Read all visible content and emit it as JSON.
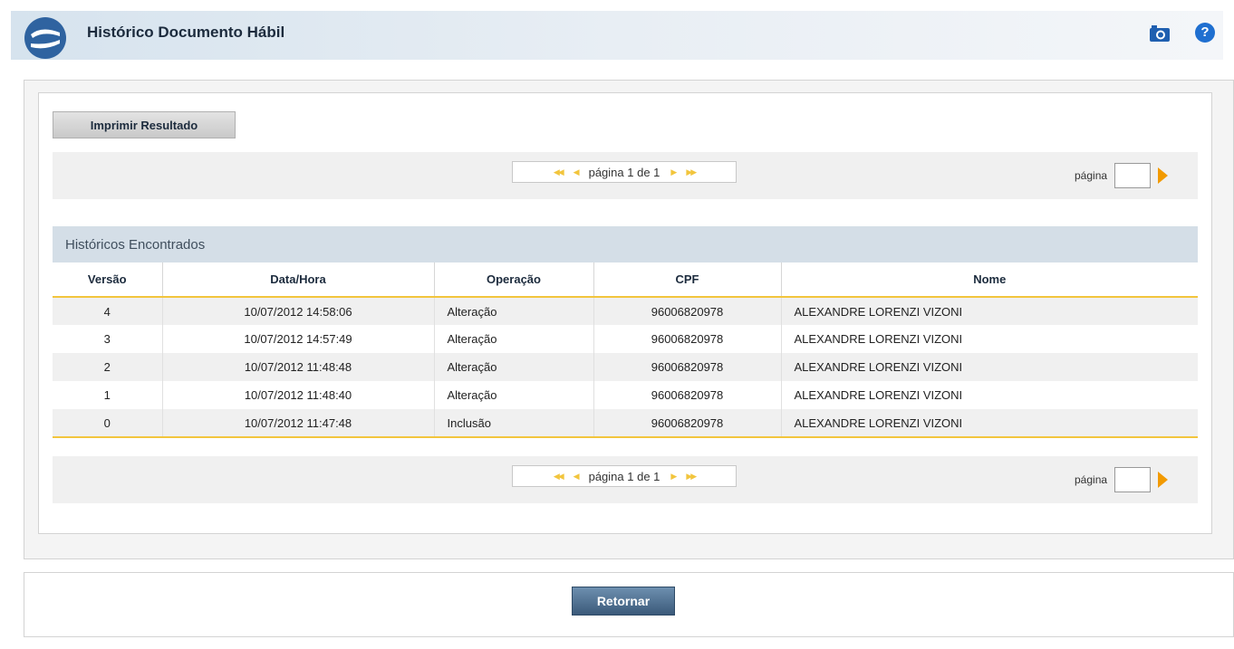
{
  "header": {
    "title": "Histórico Documento Hábil"
  },
  "toolbar": {
    "print_label": "Imprimir Resultado"
  },
  "pagination": {
    "text": "página 1 de 1",
    "go_label": "página",
    "current_page": 1,
    "total_pages": 1
  },
  "table": {
    "title": "Históricos Encontrados",
    "columns": [
      "Versão",
      "Data/Hora",
      "Operação",
      "CPF",
      "Nome"
    ],
    "rows": [
      {
        "versao": "4",
        "datahora": "10/07/2012 14:58:06",
        "operacao": "Alteração",
        "cpf": "96006820978",
        "nome": "ALEXANDRE LORENZI VIZONI"
      },
      {
        "versao": "3",
        "datahora": "10/07/2012 14:57:49",
        "operacao": "Alteração",
        "cpf": "96006820978",
        "nome": "ALEXANDRE LORENZI VIZONI"
      },
      {
        "versao": "2",
        "datahora": "10/07/2012 11:48:48",
        "operacao": "Alteração",
        "cpf": "96006820978",
        "nome": "ALEXANDRE LORENZI VIZONI"
      },
      {
        "versao": "1",
        "datahora": "10/07/2012 11:48:40",
        "operacao": "Alteração",
        "cpf": "96006820978",
        "nome": "ALEXANDRE LORENZI VIZONI"
      },
      {
        "versao": "0",
        "datahora": "10/07/2012 11:47:48",
        "operacao": "Inclusão",
        "cpf": "96006820978",
        "nome": "ALEXANDRE LORENZI VIZONI"
      }
    ]
  },
  "footer": {
    "back_label": "Retornar"
  },
  "icons": {
    "logo": "siafi-logo-icon",
    "camera": "camera-icon",
    "help": "help-icon",
    "first": "first-page-icon",
    "prev": "prev-page-icon",
    "next": "next-page-icon",
    "last": "last-page-icon",
    "go": "go-arrow-icon"
  },
  "colors": {
    "accent": "#f2c53d",
    "header_bg": "#d6e3ee",
    "help": "#1f6fd0",
    "back_button": "#3b5a7a"
  }
}
